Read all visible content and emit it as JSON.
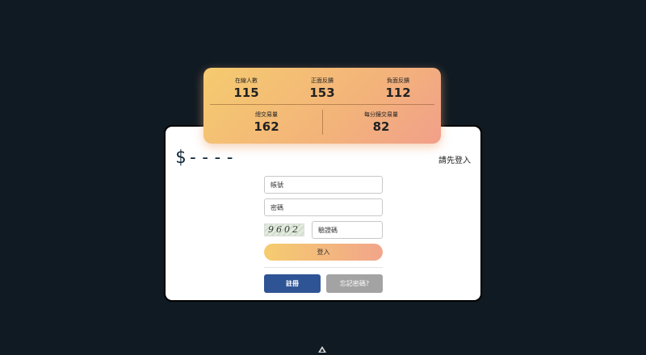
{
  "stats": {
    "online_users": {
      "label": "在線人數",
      "value": "115"
    },
    "positive_feedback": {
      "label": "正面反饋",
      "value": "153"
    },
    "negative_feedback": {
      "label": "負面反饋",
      "value": "112"
    },
    "total_trades": {
      "label": "總交易量",
      "value": "162"
    },
    "trades_per_minute": {
      "label": "每分鐘交易量",
      "value": "82"
    }
  },
  "header": {
    "logo_text": "$----",
    "login_hint": "請先登入"
  },
  "form": {
    "account_placeholder": "帳號",
    "account_value": "",
    "password_placeholder": "密碼",
    "password_value": "",
    "captcha_image_text": "9602",
    "captcha_placeholder": "驗證碼",
    "captcha_value": "",
    "login_label": "登入",
    "register_label": "註冊",
    "forgot_label": "忘記密碼?"
  },
  "colors": {
    "background": "#101a22",
    "card": "#ffffff",
    "stats_gradient_start": "#f5cb6f",
    "stats_gradient_end": "#f2a08a",
    "register_button": "#2f5495",
    "forgot_button": "#a3a3a3"
  },
  "icons": {
    "bottom": "triangle-logo-icon"
  }
}
